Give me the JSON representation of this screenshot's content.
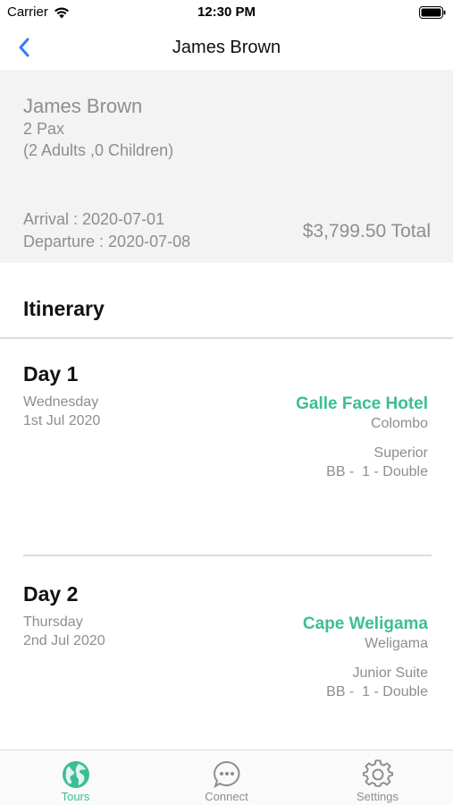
{
  "status_bar": {
    "carrier": "Carrier",
    "time": "12:30 PM"
  },
  "nav": {
    "back_icon": "chevron-left-icon",
    "title": "James Brown"
  },
  "summary": {
    "guest_name": "James Brown",
    "pax": "2 Pax",
    "pax_detail": "(2 Adults ,0 Children)",
    "arrival": "Arrival : 2020-07-01",
    "departure": "Departure : 2020-07-08",
    "total": "$3,799.50 Total"
  },
  "itinerary": {
    "title": "Itinerary",
    "days": [
      {
        "title": "Day 1",
        "weekday": "Wednesday",
        "date": "1st Jul 2020",
        "hotel": "Galle Face Hotel",
        "city": "Colombo",
        "room_type": "Superior",
        "board": "BB -  1 - Double"
      },
      {
        "title": "Day 2",
        "weekday": "Thursday",
        "date": "2nd Jul 2020",
        "hotel": "Cape Weligama",
        "city": "Weligama",
        "room_type": "Junior Suite",
        "board": "BB -  1 - Double"
      }
    ]
  },
  "tabs": [
    {
      "label": "Tours",
      "icon": "globe-icon",
      "active": true
    },
    {
      "label": "Connect",
      "icon": "chat-bubble-icon",
      "active": false
    },
    {
      "label": "Settings",
      "icon": "gear-icon",
      "active": false
    }
  ],
  "colors": {
    "accent": "#3dbd96",
    "nav_tint": "#2f7df6",
    "secondary_text": "#8e8e8e",
    "summary_background": "#f3f3f3"
  }
}
